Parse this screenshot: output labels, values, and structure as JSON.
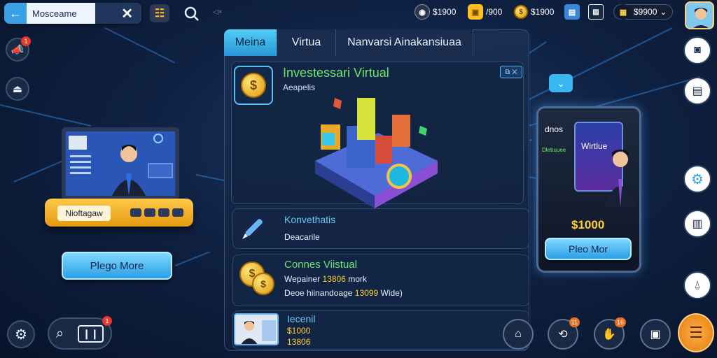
{
  "topbar": {
    "search_text": "Mosceame",
    "back_icon": "back-arrow-icon",
    "close_label": "✕",
    "resources": [
      {
        "icon": "dark-coin-icon",
        "value": "$1900",
        "color": "#2b3548"
      },
      {
        "icon": "gold-bag-icon",
        "value": "/900",
        "color": "#ffbf1f"
      },
      {
        "icon": "gold-coin-icon",
        "value": "$1900",
        "color": "#f0a91d"
      },
      {
        "icon": "chart-card-icon",
        "value": "",
        "color": "#3a86d8"
      },
      {
        "icon": "wallet-card-icon",
        "value": "$9900",
        "color": "#ffd34d"
      }
    ]
  },
  "left": {
    "notification_badge": "1",
    "laptop_label": "Nioftagaw",
    "play_more_label": "Plego More",
    "bottom_badge": "1"
  },
  "main": {
    "tabs": [
      {
        "label": "Meina"
      },
      {
        "label": "Virtua"
      },
      {
        "label": "Nanvarsi Ainakansiuaa"
      }
    ],
    "hero": {
      "title": "Investessari Virtual",
      "subtitle": "Aeapelis",
      "chip": "⧉ ✕"
    },
    "rows": [
      {
        "title": "Konvethatis",
        "subtitle": "Deacarile"
      },
      {
        "title": "Connes Viistual",
        "line1_label": "Wepainer",
        "line1_value": "13806",
        "line1_tail": "mork",
        "line2_label": "Deoe",
        "line2_mid": "hiinandoage",
        "line2_value": "13099",
        "line2_tail": "Wide)"
      },
      {
        "title": "Iecenil",
        "line1": "$1000",
        "line2": "13806"
      }
    ]
  },
  "right": {
    "phone_heading": "dnos",
    "phone_banner": "Wirtlue",
    "phone_caption": "Dlebuuee",
    "phone_price": "$1000",
    "phone_button": "Pleo Mor",
    "bottom_badges": [
      "11",
      "16"
    ]
  }
}
